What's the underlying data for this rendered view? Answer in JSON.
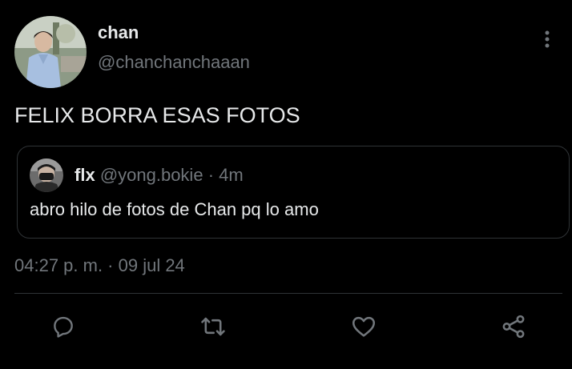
{
  "author": {
    "name": "chan",
    "handle": "@chanchanchaaan"
  },
  "tweet": {
    "text": "FELIX BORRA ESAS FOTOS",
    "date": "04:27 p. m. · 09 jul 24"
  },
  "quote": {
    "name": "flx",
    "handle": "@yong.bokie",
    "separator": "·",
    "age": "4m",
    "text": "abro hilo de fotos de Chan pq lo amo"
  },
  "actions": [
    "reply-icon",
    "retweet-icon",
    "like-icon",
    "share-icon"
  ],
  "colors": {
    "background": "#000000",
    "primary_text": "#e7e9ea",
    "secondary_text": "#71767b",
    "border": "#2f3336"
  }
}
